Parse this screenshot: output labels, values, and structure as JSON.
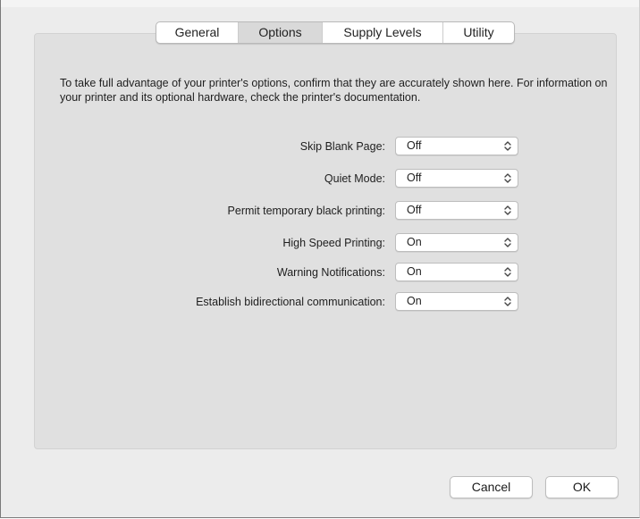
{
  "tabs": [
    {
      "label": "General"
    },
    {
      "label": "Options",
      "active": true
    },
    {
      "label": "Supply Levels"
    },
    {
      "label": "Utility"
    }
  ],
  "intro": "To take full advantage of your printer's options, confirm that they are accurately shown here. For information on your printer and its optional hardware, check the printer's documentation.",
  "options": [
    {
      "label": "Skip Blank Page:",
      "value": "Off"
    },
    {
      "label": "Quiet Mode:",
      "value": "Off"
    },
    {
      "label": "Permit temporary black printing:",
      "value": "Off"
    },
    {
      "label": "High Speed Printing:",
      "value": "On"
    },
    {
      "label": "Warning Notifications:",
      "value": "On"
    },
    {
      "label": "Establish bidirectional communication:",
      "value": "On"
    }
  ],
  "buttons": {
    "cancel": "Cancel",
    "ok": "OK"
  },
  "icons": {
    "popup": "up-down-chevron-icon"
  }
}
